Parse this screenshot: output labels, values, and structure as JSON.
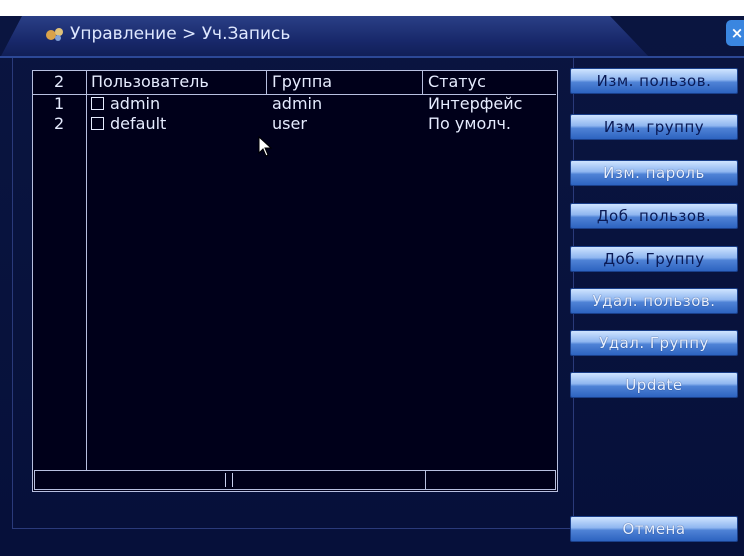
{
  "window": {
    "title": "Управление > Уч.Запись",
    "close_label": "×"
  },
  "table": {
    "count": "2",
    "columns": [
      "Пользователь",
      "Группа",
      "Статус"
    ],
    "rows": [
      {
        "index": "1",
        "user": "admin",
        "group": "admin",
        "status": "Интерфейс"
      },
      {
        "index": "2",
        "user": "default",
        "group": "user",
        "status": "По умолч."
      }
    ]
  },
  "buttons": {
    "modify_user": "Изм. пользов.",
    "modify_group": "Изм. группу",
    "modify_password": "Изм. пароль",
    "add_user": "Доб. пользов.",
    "add_group": "Доб. Группу",
    "delete_user": "Удал. пользов.",
    "delete_group": "Удал. Группу",
    "update": "Update",
    "cancel": "Отмена"
  },
  "colors": {
    "background": "#06103a",
    "button_gradient_top": "#cfe4ff",
    "button_gradient_bottom": "#2d63c0",
    "text": "#e6ecff"
  }
}
